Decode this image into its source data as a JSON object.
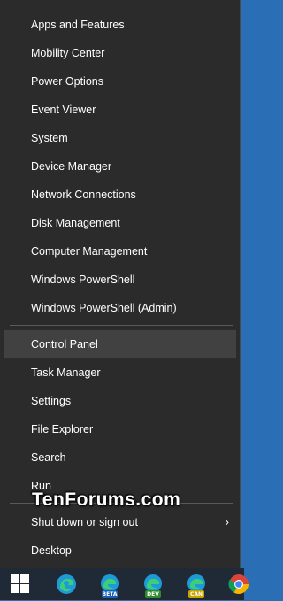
{
  "menu": {
    "items": [
      {
        "label": "Apps and Features"
      },
      {
        "label": "Mobility Center"
      },
      {
        "label": "Power Options"
      },
      {
        "label": "Event Viewer"
      },
      {
        "label": "System"
      },
      {
        "label": "Device Manager"
      },
      {
        "label": "Network Connections"
      },
      {
        "label": "Disk Management"
      },
      {
        "label": "Computer Management"
      },
      {
        "label": "Windows PowerShell"
      },
      {
        "label": "Windows PowerShell (Admin)"
      },
      {
        "label": "Control Panel"
      },
      {
        "label": "Task Manager"
      },
      {
        "label": "Settings"
      },
      {
        "label": "File Explorer"
      },
      {
        "label": "Search"
      },
      {
        "label": "Run"
      },
      {
        "label": "Shut down or sign out"
      },
      {
        "label": "Desktop"
      }
    ],
    "highlighted_index": 11,
    "submenu_arrow": "›"
  },
  "watermark": "TenForums.com",
  "taskbar": {
    "icons": [
      {
        "name": "windows-start-icon"
      },
      {
        "name": "edge-icon"
      },
      {
        "name": "edge-beta-icon",
        "badge": "BETA"
      },
      {
        "name": "edge-dev-icon",
        "badge": "DEV"
      },
      {
        "name": "edge-canary-icon",
        "badge": "CAN"
      },
      {
        "name": "chrome-icon"
      }
    ]
  },
  "colors": {
    "menu_bg": "#2b2b2b",
    "highlight": "#414141",
    "taskbar_bg": "#1f2a36",
    "desktop_bg": "#2a6fb5"
  }
}
